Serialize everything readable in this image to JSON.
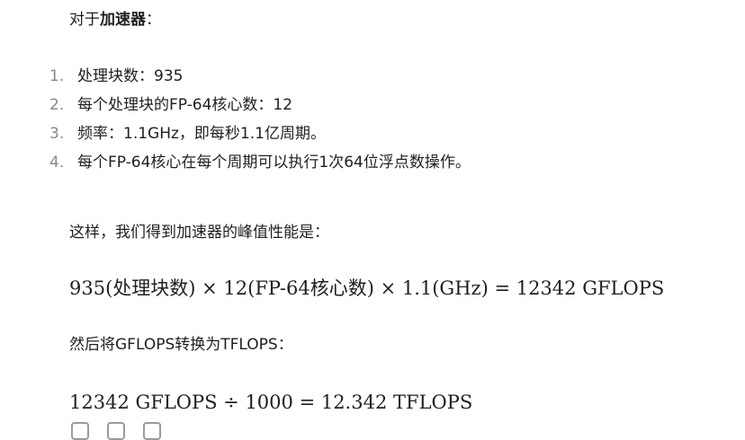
{
  "intro": {
    "prefix": "对于",
    "bold": "加速器",
    "suffix": "："
  },
  "steps": [
    {
      "num": "1.",
      "text": "处理块数：935"
    },
    {
      "num": "2.",
      "text": "每个处理块的FP-64核心数：12"
    },
    {
      "num": "3.",
      "text": "频率：1.1GHz，即每秒1.1亿周期。"
    },
    {
      "num": "4.",
      "text": "每个FP-64核心在每个周期可以执行1次64位浮点数操作。"
    }
  ],
  "para2": "这样，我们得到加速器的峰值性能是：",
  "formula1": "935(处理块数) × 12(FP-64核心数) × 1.1(GHz) = 12342 GFLOPS",
  "para3": "然后将GFLOPS转换为TFLOPS：",
  "formula2": "12342 GFLOPS ÷ 1000 = 12.342 TFLOPS",
  "actions": {
    "icons": [
      "copy-icon",
      "refresh-icon",
      "bookmark-icon"
    ]
  }
}
